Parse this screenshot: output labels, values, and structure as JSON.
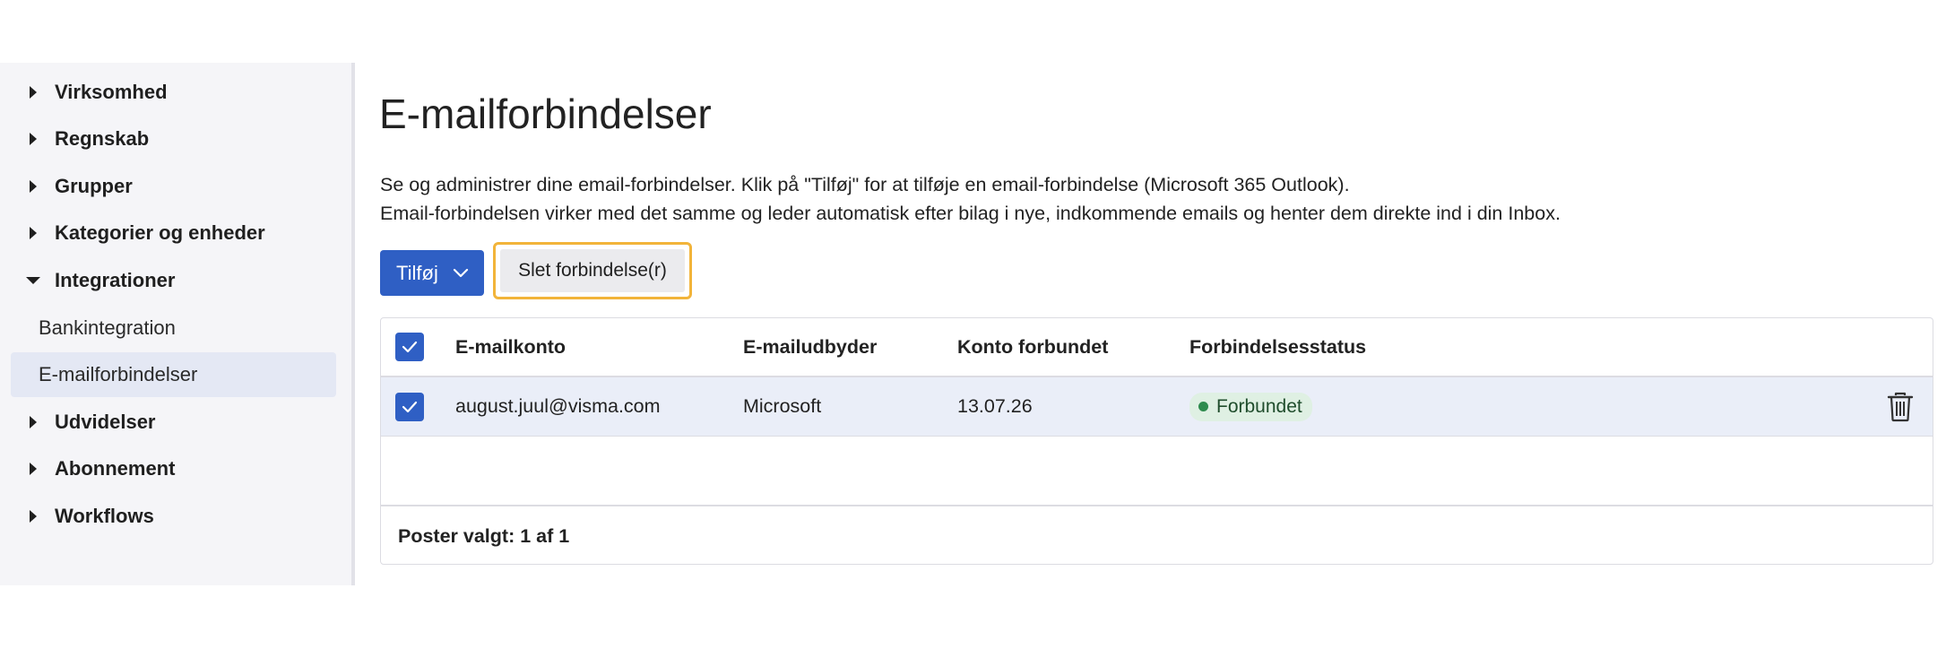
{
  "sidebar": {
    "items": [
      {
        "label": "Virksomhed",
        "expanded": false
      },
      {
        "label": "Regnskab",
        "expanded": false
      },
      {
        "label": "Grupper",
        "expanded": false
      },
      {
        "label": "Kategorier og enheder",
        "expanded": false
      },
      {
        "label": "Integrationer",
        "expanded": true
      },
      {
        "label": "Udvidelser",
        "expanded": false
      },
      {
        "label": "Abonnement",
        "expanded": false
      },
      {
        "label": "Workflows",
        "expanded": false
      }
    ],
    "subitems": [
      {
        "label": "Bankintegration",
        "active": false
      },
      {
        "label": "E-mailforbindelser",
        "active": true
      }
    ]
  },
  "page": {
    "title": "E-mailforbindelser",
    "description_line1": "Se og administrer dine email-forbindelser. Klik på \"Tilføj\" for at tilføje en email-forbindelse (Microsoft 365 Outlook).",
    "description_line2": "Email-forbindelsen virker med det samme og leder automatisk efter bilag i nye, indkommende emails og henter dem direkte ind i din Inbox."
  },
  "toolbar": {
    "add_label": "Tilføj",
    "delete_label": "Slet forbindelse(r)"
  },
  "table": {
    "columns": [
      "E-mailkonto",
      "E-mailudbyder",
      "Konto forbundet",
      "Forbindelsesstatus"
    ],
    "rows": [
      {
        "account": "august.juul@visma.com",
        "provider": "Microsoft",
        "connected": "13.07.26",
        "status": "Forbundet",
        "selected": true
      }
    ],
    "footer": "Poster valgt: 1 af 1"
  },
  "colors": {
    "primary": "#2f5fc4",
    "highlight": "#f2b43a",
    "status_bg": "#dff0e3",
    "status_dot": "#2e8b4e",
    "selected_row": "#eaeef8"
  }
}
